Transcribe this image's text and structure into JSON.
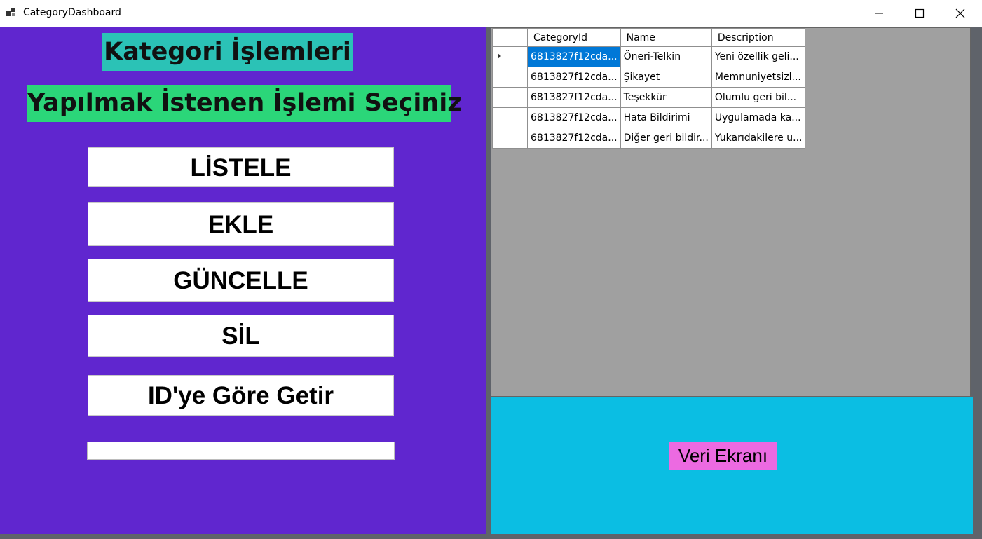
{
  "window": {
    "title": "CategoryDashboard",
    "controls": [
      "minimize",
      "maximize",
      "close"
    ]
  },
  "left_panel": {
    "heading": "Kategori İşlemleri",
    "subheading": "Yapılmak İstenen İşlemi Seçiniz",
    "buttons": {
      "list": "LİSTELE",
      "add": "EKLE",
      "update": "GÜNCELLE",
      "delete": "SİL",
      "get_by_id": "ID'ye Göre Getir"
    },
    "id_input_value": ""
  },
  "grid": {
    "columns": [
      "CategoryId",
      "Name",
      "Description"
    ],
    "rows": [
      {
        "CategoryId": "6813827f12cda...",
        "Name": "Öneri-Telkin",
        "Description": "Yeni özellik geli..."
      },
      {
        "CategoryId": "6813827f12cda...",
        "Name": "Şikayet",
        "Description": "Memnuniyetsizl..."
      },
      {
        "CategoryId": "6813827f12cda...",
        "Name": "Teşekkür",
        "Description": "Olumlu geri bil..."
      },
      {
        "CategoryId": "6813827f12cda...",
        "Name": "Hata Bildirimi",
        "Description": "Uygulamada ka..."
      },
      {
        "CategoryId": "6813827f12cda...",
        "Name": "Diğer geri bildir...",
        "Description": "Yukarıdakilere u..."
      }
    ],
    "selected_row": 0
  },
  "data_panel": {
    "label": "Veri Ekranı"
  },
  "colors": {
    "left_panel": "#6026cf",
    "heading_bg": "#2bc2b6",
    "subheading_bg": "#2bd679",
    "data_panel": "#0bbee3",
    "label_bg": "#ec6ae1",
    "grid_bg": "#a0a0a0",
    "selection": "#0078d7"
  }
}
